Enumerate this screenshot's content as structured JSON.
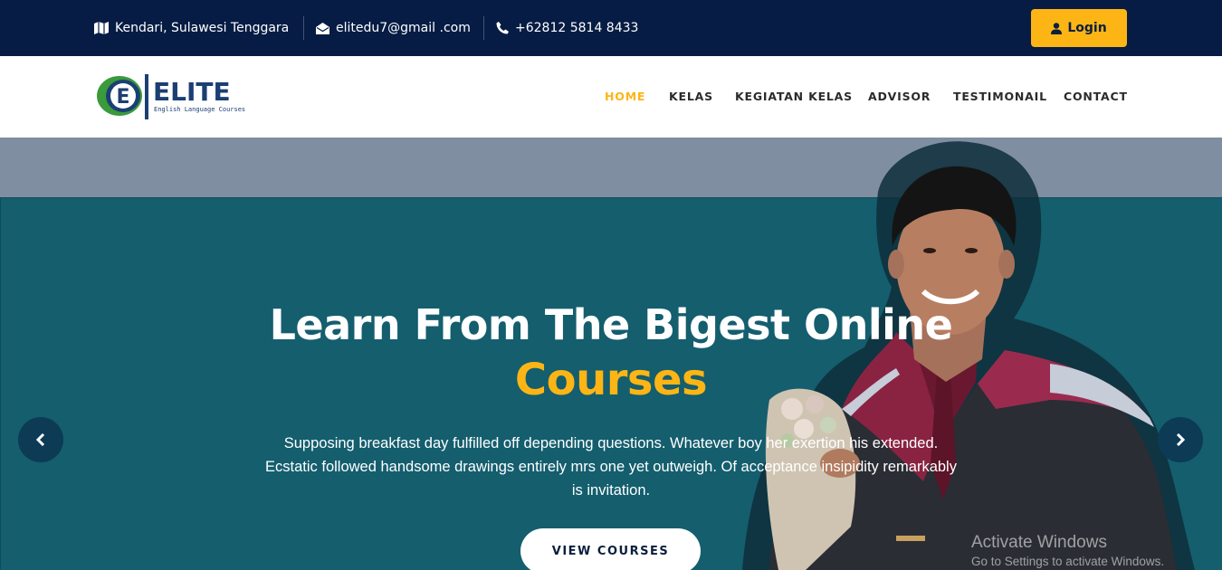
{
  "topbar": {
    "location": "Kendari, Sulawesi Tenggara",
    "email": "elitedu7@gmail .com",
    "phone": "+62812 5814 8433",
    "login_label": "Login"
  },
  "logo": {
    "text": "ELITE",
    "tagline": "English Language Courses"
  },
  "nav": {
    "items": [
      {
        "label": "HOME",
        "active": true
      },
      {
        "label": "KELAS"
      },
      {
        "label": "KEGIATAN KELAS"
      },
      {
        "label": "ADVISOR"
      },
      {
        "label": "TESTIMONAIL"
      },
      {
        "label": "CONTACT"
      }
    ]
  },
  "hero": {
    "headline_line1": "Learn From The Bigest Online",
    "headline_line2": "Courses",
    "description": "Supposing breakfast day fulfilled off depending questions. Whatever boy her exertion his extended. Ecstatic followed handsome drawings entirely mrs one yet outweigh. Of acceptance insipidity remarkably is invitation.",
    "button_label": "VIEW COURSES"
  },
  "watermark": {
    "title": "Activate Windows",
    "subtitle": "Go to Settings to activate Windows."
  },
  "colors": {
    "topbar_bg": "#061c44",
    "accent": "#fdb515",
    "hero_teal": "#145e6e"
  },
  "icons": [
    "map-icon",
    "envelope-icon",
    "phone-icon",
    "user-icon",
    "chevron-left-icon",
    "chevron-right-icon"
  ]
}
